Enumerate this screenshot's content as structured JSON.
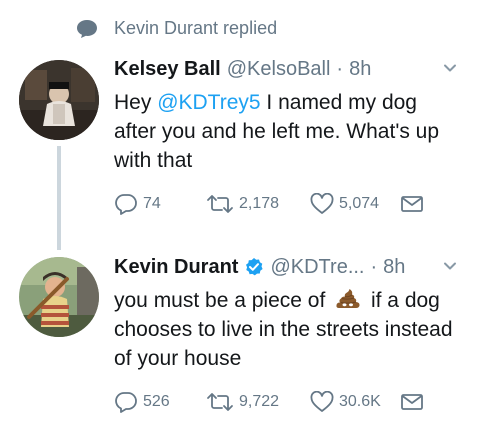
{
  "context": {
    "replied_text": "Kevin Durant replied"
  },
  "tweets": [
    {
      "name": "Kelsey Ball",
      "handle": "@KelsoBall",
      "separator": "·",
      "time": "8h",
      "text_pre": "Hey ",
      "mention": "@KDTrey5",
      "text_post": " I named my dog after you and he left me. What's up with that",
      "replies": "74",
      "retweets": "2,178",
      "likes": "5,074"
    },
    {
      "name": "Kevin Durant",
      "handle": "@KDTre...",
      "separator": "·",
      "time": "8h",
      "verified": true,
      "text_pre": "you must be a piece of ",
      "emoji": "pile-of-poo",
      "text_post": " if a dog chooses to live in the streets instead of your house",
      "replies": "526",
      "retweets": "9,722",
      "likes": "30.6K"
    }
  ],
  "colors": {
    "muted": "#657786",
    "link": "#1da1f2",
    "verified": "#1da1f2",
    "thread_line": "#ccd6dd"
  }
}
